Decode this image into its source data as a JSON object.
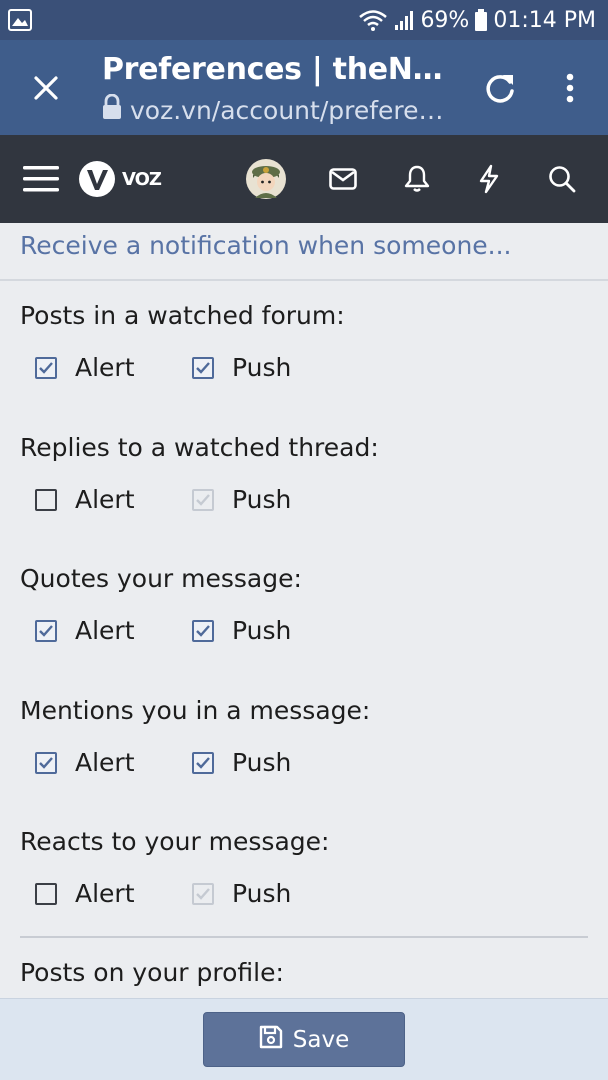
{
  "status_bar": {
    "battery": "69%",
    "time": "01:14 PM",
    "icons": [
      "image-icon",
      "wifi-icon",
      "signal-icon",
      "battery-icon"
    ]
  },
  "browser": {
    "title": "Preferences | theNEXT Voz",
    "url": "voz.vn/account/preferences",
    "icons": [
      "close-icon",
      "lock-icon",
      "reload-icon",
      "more-vert-icon"
    ]
  },
  "navbar": {
    "logo_text": "VOZ",
    "icons": [
      "hamburger-icon",
      "voz-logo",
      "avatar",
      "mail-icon",
      "bell-icon",
      "bolt-icon",
      "search-icon"
    ]
  },
  "section": {
    "heading": "Receive a notification when someone..."
  },
  "groups": [
    {
      "label": "Posts in a watched forum:",
      "alert": "Alert",
      "push": "Push",
      "alert_state": "checked",
      "push_state": "checked"
    },
    {
      "label": "Replies to a watched thread:",
      "alert": "Alert",
      "push": "Push",
      "alert_state": "unchecked",
      "push_state": "disabled"
    },
    {
      "label": "Quotes your message:",
      "alert": "Alert",
      "push": "Push",
      "alert_state": "checked",
      "push_state": "checked"
    },
    {
      "label": "Mentions you in a message:",
      "alert": "Alert",
      "push": "Push",
      "alert_state": "checked",
      "push_state": "checked"
    },
    {
      "label": "Reacts to your message:",
      "alert": "Alert",
      "push": "Push",
      "alert_state": "unchecked",
      "push_state": "disabled"
    },
    {
      "label": "Posts on your profile:"
    }
  ],
  "footer": {
    "save_label": "Save"
  },
  "colors": {
    "status_bar": "#3a5078",
    "browser_bar": "#3f5d8b",
    "navbar": "#31363f",
    "accent": "#5873a5",
    "save_button": "#5d7299"
  }
}
